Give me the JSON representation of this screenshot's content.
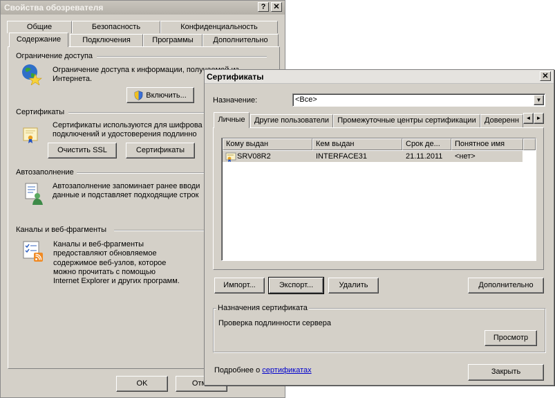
{
  "back": {
    "title": "Свойства обозревателя",
    "help_label": "?",
    "close_label": "✕",
    "tabs_row1": [
      "Общие",
      "Безопасность",
      "Конфиденциальность"
    ],
    "tabs_row2": [
      "Содержание",
      "Подключения",
      "Программы",
      "Дополнительно"
    ],
    "access": {
      "title": "Ограничение доступа",
      "line1": "Ограничение доступа к информации, получаемой из",
      "line2": "Интернета.",
      "enable_button": "Включить..."
    },
    "certs": {
      "title": "Сертификаты",
      "line1": "Сертификаты используются для шифрова",
      "line2": "подключений и удостоверения подлинно",
      "clear_ssl_button": "Очистить SSL",
      "certs_button": "Сертификаты"
    },
    "autofill": {
      "title": "Автозаполнение",
      "line1": "Автозаполнение запоминает ранее вводи",
      "line2": "данные и подставляет подходящие строк"
    },
    "feeds": {
      "title": "Каналы и веб-фрагменты",
      "line1": "Каналы и веб-фрагменты",
      "line2": "предоставляют обновляемое",
      "line3": "содержимое веб-узлов, которое",
      "line4": "можно прочитать с помощью",
      "line5": "Internet Explorer и других программ."
    },
    "ok_button": "OK",
    "cancel_button": "Отме"
  },
  "dialog": {
    "title": "Сертификаты",
    "close_label": "✕",
    "purpose_label": "Назначение:",
    "purpose_value": "<Все>",
    "tabs": [
      "Личные",
      "Другие пользователи",
      "Промежуточные центры сертификации",
      "Доверенн"
    ],
    "scroll_left": "◄",
    "scroll_right": "►",
    "columns": [
      "Кому выдан",
      "Кем выдан",
      "Срок де...",
      "Понятное имя"
    ],
    "rows": [
      {
        "issued_to": "SRV08R2",
        "issued_by": "INTERFACE31",
        "expires": "21.11.2011",
        "friendly_name": "<нет>"
      }
    ],
    "import_button": "Импорт...",
    "export_button": "Экспорт...",
    "delete_button": "Удалить",
    "advanced_button": "Дополнительно",
    "purposes_group_title": "Назначения сертификата",
    "purposes_text": "Проверка подлинности сервера",
    "view_button": "Просмотр",
    "more_prefix": "Подробнее о",
    "more_link": "сертификатах",
    "close_button": "Закрыть"
  }
}
